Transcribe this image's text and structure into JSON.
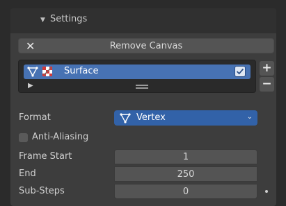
{
  "panel": {
    "title": "Settings",
    "collapse_glyph": "▼"
  },
  "remove_canvas": {
    "icon": "close-icon",
    "icon_glyph": "✕",
    "label": "Remove Canvas"
  },
  "canvas_list": {
    "items": [
      {
        "name": "Surface",
        "type_icon": "vertex-icon",
        "texture_icon": "checker-texture-icon",
        "enabled": true,
        "selected": true
      }
    ],
    "expand_glyph": "▶"
  },
  "list_controls": {
    "add_glyph": "+",
    "remove_glyph": "−"
  },
  "properties": {
    "format": {
      "label": "Format",
      "value": "Vertex",
      "icon": "vertex-icon"
    },
    "anti_aliasing": {
      "label": "Anti-Aliasing",
      "checked": false
    },
    "frame_start": {
      "label": "Frame Start",
      "value": "1"
    },
    "end": {
      "label": "End",
      "value": "250"
    },
    "sub_steps": {
      "label": "Sub-Steps",
      "value": "0"
    }
  },
  "colors": {
    "background": "#2b2b2b",
    "panel": "#3d3d3d",
    "accent": "#4772b3",
    "select_bg": "#3262a8",
    "field_bg": "#545454"
  }
}
